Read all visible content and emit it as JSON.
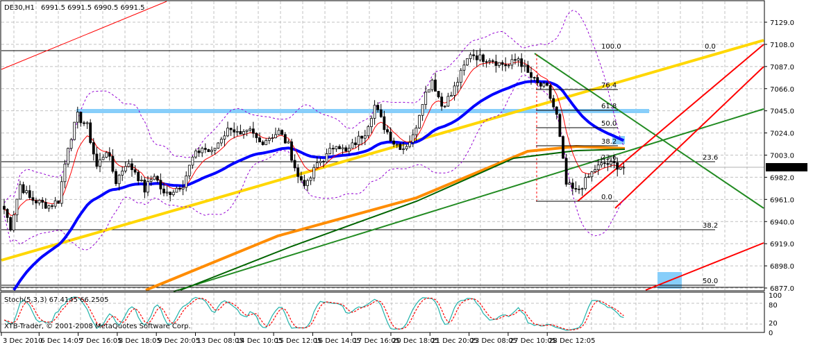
{
  "header": {
    "symbol": "DE30,H1",
    "ohlc": "6991.5 6991.5 6990.5 6991.5"
  },
  "stoch": {
    "label": "Stoch(5,3,3) 67.4145 66.2505",
    "levels": [
      "100",
      "80",
      "20",
      "0"
    ]
  },
  "copyright": "XTB-Trader, © 2001-2008 MetaQuotes Software Corp.",
  "chart_data": {
    "type": "candlestick",
    "title": "DE30,H1",
    "ylim": [
      6877.0,
      7129.0
    ],
    "y_ticks": [
      "7129.0",
      "7108.0",
      "7087.0",
      "7066.0",
      "7045.0",
      "7024.0",
      "7003.0",
      "6982.0",
      "6961.0",
      "6940.0",
      "6919.0",
      "6898.0",
      "6877.0"
    ],
    "x_ticks": [
      "3 Dec 2010",
      "6 Dec 14:05",
      "7 Dec 16:05",
      "8 Dec 18:05",
      "9 Dec 20:05",
      "13 Dec 08:05",
      "14 Dec 10:05",
      "15 Dec 12:05",
      "16 Dec 14:05",
      "17 Dec 16:05",
      "20 Dec 18:05",
      "21 Dec 20:05",
      "23 Dec 08:05",
      "27 Dec 10:05",
      "28 Dec 12:05"
    ],
    "current_price": "6991.5",
    "approx_closes": [
      6960,
      6935,
      6975,
      6962,
      6958,
      6955,
      6960,
      7012,
      7040,
      7030,
      6992,
      7008,
      6978,
      6995,
      6988,
      6970,
      6985,
      6965,
      6970,
      6976,
      7000,
      7010,
      7005,
      7020,
      7030,
      7020,
      7025,
      7015,
      7020,
      7025,
      7012,
      6982,
      6975,
      6995,
      7002,
      7015,
      7005,
      7015,
      7025,
      7050,
      7030,
      7015,
      7010,
      7020,
      7055,
      7075,
      7050,
      7060,
      7080,
      7100,
      7095,
      7095,
      7090,
      7088,
      7095,
      7080,
      7070,
      7066,
      7040,
      6975,
      6968,
      6978,
      6990,
      6995,
      6994,
      6991.5
    ],
    "fibonacci_levels": [
      "100.0",
      "76.4",
      "61.8",
      "50.0",
      "38.2",
      "23.6",
      "0.0"
    ],
    "fib_extension_labels": [
      "0.0",
      "23.6",
      "38.2",
      "50.0"
    ],
    "grid": true,
    "colors": {
      "ema_fast": "#ff0000",
      "ema_slow": "#0000ff",
      "ma_long": "#ff8c00",
      "ma_green": "#006400",
      "trend_yellow": "#ffd700",
      "zone": "#87cefa",
      "bands": "#9400d3",
      "stoch_main": "#20b2aa",
      "stoch_signal": "#ff0000"
    }
  }
}
